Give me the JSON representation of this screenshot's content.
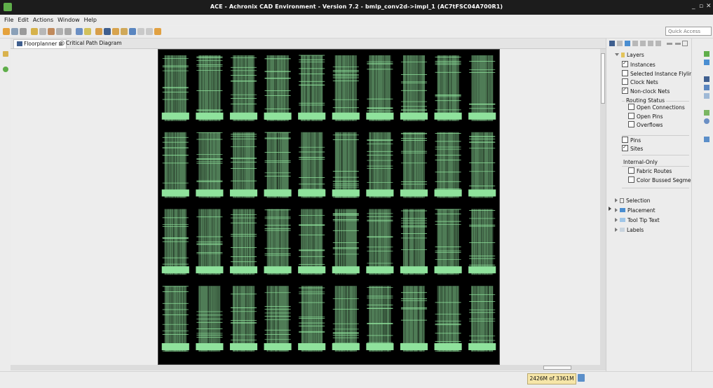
{
  "window": {
    "title": "ACE - Achronix CAD Environment - Version 7.2 - bmlp_conv2d->impl_1 (AC7tFSC04A700R1)",
    "controls": [
      "_",
      "▫",
      "✕"
    ]
  },
  "menu": [
    "File",
    "Edit",
    "Actions",
    "Window",
    "Help"
  ],
  "toolbar": {
    "quick_access_placeholder": "Quick Access"
  },
  "editor_tabs": [
    {
      "label": "Floorplanner ⊠",
      "active": true
    },
    {
      "label": "Critical Path Diagram",
      "active": false
    }
  ],
  "layers": {
    "title": "Layers",
    "items": [
      {
        "label": "Instances",
        "checked": true
      },
      {
        "label": "Selected Instance Flyline",
        "checked": false
      },
      {
        "label": "Clock Nets",
        "checked": false
      },
      {
        "label": "Non-clock Nets",
        "checked": true
      }
    ],
    "routing_status": {
      "title": "Routing Status",
      "items": [
        {
          "label": "Open Connections",
          "checked": false
        },
        {
          "label": "Open Pins",
          "checked": false
        },
        {
          "label": "Overflows",
          "checked": false
        }
      ]
    },
    "items2": [
      {
        "label": "Pins",
        "checked": false
      },
      {
        "label": "Sites",
        "checked": true
      }
    ],
    "internal_only": {
      "title": "Internal-Only",
      "items": [
        {
          "label": "Fabric Routes",
          "checked": false
        },
        {
          "label": "Color Bussed Segment",
          "checked": false
        }
      ]
    }
  },
  "sections": [
    "Selection",
    "Placement",
    "Tool Tip Text",
    "Labels"
  ],
  "status": {
    "memory": "2426M of 3361M"
  },
  "colors": {
    "routing": "#8fe29c",
    "chip_background": "#000000",
    "title_bar": "#1c1c1c"
  }
}
